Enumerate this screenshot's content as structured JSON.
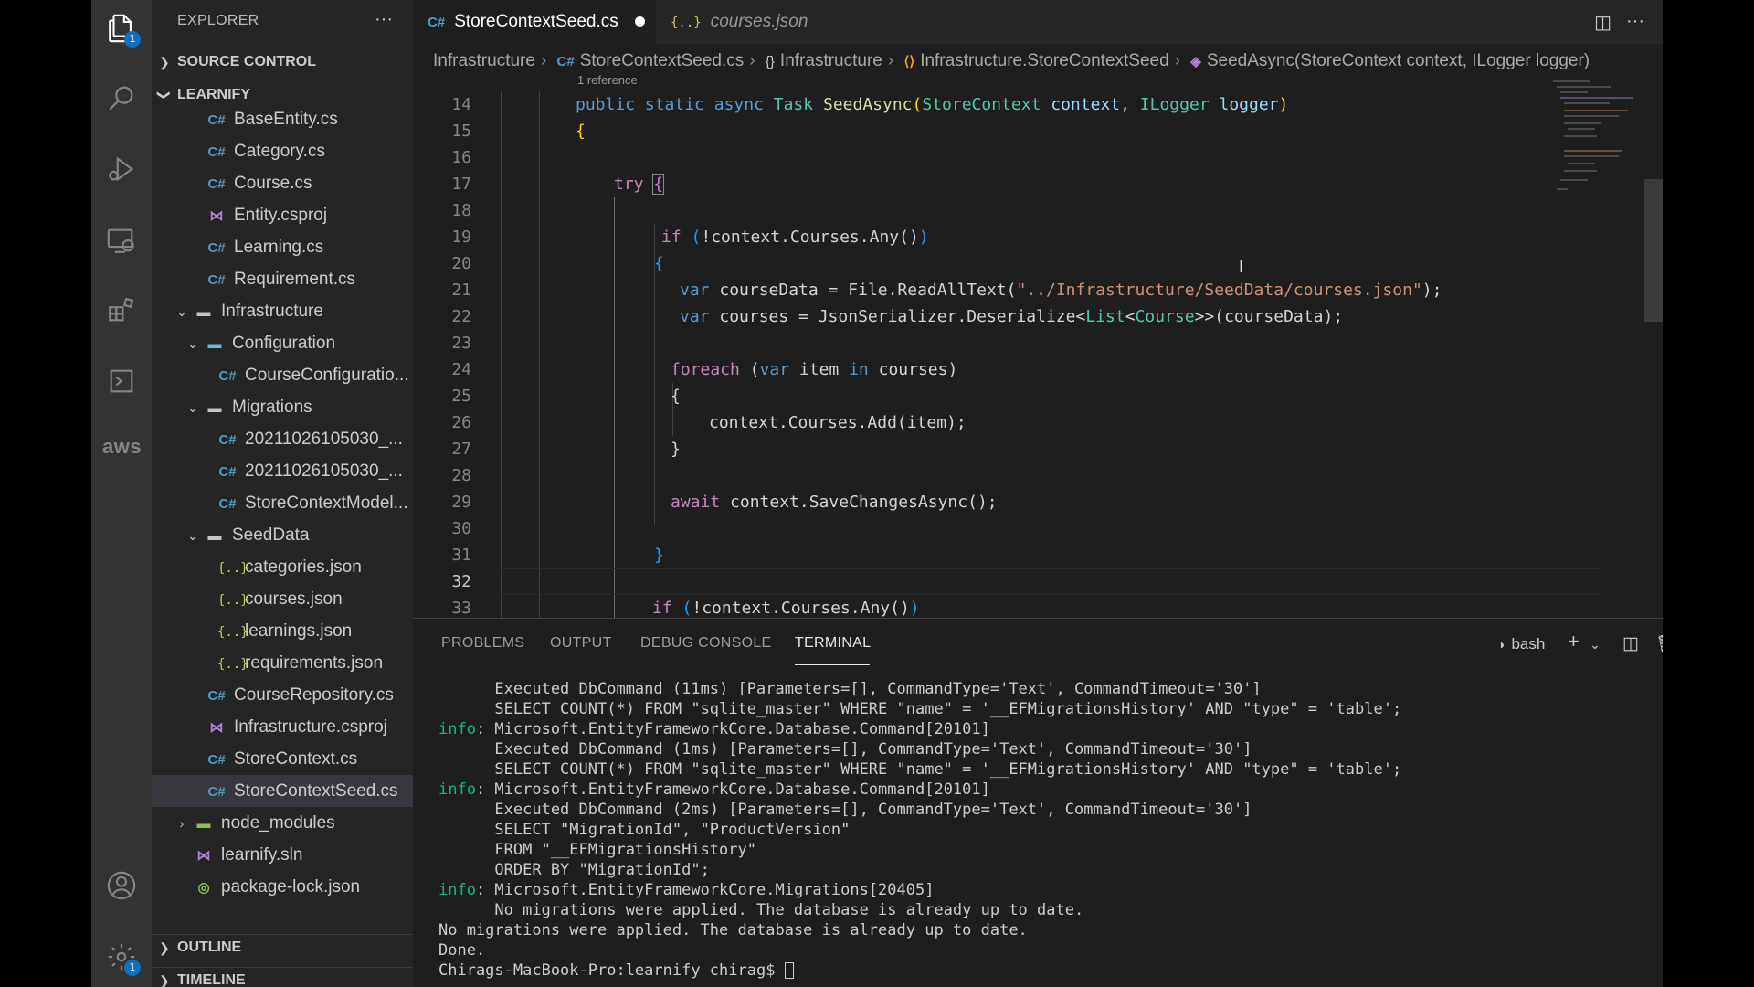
{
  "sidebar": {
    "title": "EXPLORER",
    "more": "···",
    "sections": {
      "source_control": "SOURCE CONTROL",
      "project": "LEARNIFY",
      "outline": "OUTLINE",
      "timeline": "TIMELINE"
    },
    "files": [
      {
        "label": "BaseEntity.cs",
        "icon": "C#"
      },
      {
        "label": "Category.cs",
        "icon": "C#"
      },
      {
        "label": "Course.cs",
        "icon": "C#"
      },
      {
        "label": "Entity.csproj",
        "icon": "csproj"
      },
      {
        "label": "Learning.cs",
        "icon": "C#"
      },
      {
        "label": "Requirement.cs",
        "icon": "C#"
      },
      {
        "label": "Infrastructure",
        "icon": "folder"
      },
      {
        "label": "Configuration",
        "icon": "folder"
      },
      {
        "label": "CourseConfiguratio...",
        "icon": "C#"
      },
      {
        "label": "Migrations",
        "icon": "folder"
      },
      {
        "label": "20211026105030_...",
        "icon": "C#"
      },
      {
        "label": "20211026105030_...",
        "icon": "C#"
      },
      {
        "label": "StoreContextModel...",
        "icon": "C#"
      },
      {
        "label": "SeedData",
        "icon": "folder"
      },
      {
        "label": "categories.json",
        "icon": "{..}"
      },
      {
        "label": "courses.json",
        "icon": "{..}"
      },
      {
        "label": "learnings.json",
        "icon": "{..}"
      },
      {
        "label": "requirements.json",
        "icon": "{..}"
      },
      {
        "label": "CourseRepository.cs",
        "icon": "C#"
      },
      {
        "label": "Infrastructure.csproj",
        "icon": "csproj"
      },
      {
        "label": "StoreContext.cs",
        "icon": "C#"
      },
      {
        "label": "StoreContextSeed.cs",
        "icon": "C#"
      },
      {
        "label": "node_modules",
        "icon": "folder"
      },
      {
        "label": "learnify.sln",
        "icon": "sln"
      },
      {
        "label": "package-lock.json",
        "icon": "lock"
      }
    ]
  },
  "activity_bar": {
    "explorer_badge": "1",
    "settings_badge": "1",
    "aws_label": "aws"
  },
  "tabs": [
    {
      "label": "StoreContextSeed.cs",
      "icon": "C#"
    },
    {
      "label": "courses.json",
      "icon": "{..}"
    }
  ],
  "breadcrumb": {
    "items": [
      "Infrastructure",
      "StoreContextSeed.cs",
      "Infrastructure",
      "Infrastructure.StoreContextSeed",
      "SeedAsync(StoreContext context, ILogger logger)"
    ],
    "icons": [
      "",
      "C#",
      "{}",
      "⟨⟩",
      "◈"
    ]
  },
  "editor": {
    "codelens": "1 reference",
    "line_numbers": [
      "14",
      "15",
      "16",
      "17",
      "18",
      "19",
      "20",
      "21",
      "22",
      "23",
      "24",
      "25",
      "26",
      "27",
      "28",
      "29",
      "30",
      "31",
      "32",
      "33"
    ],
    "current_line": "32",
    "tokens": {
      "l14": [
        "public",
        "static",
        "async",
        "Task",
        "SeedAsync",
        "(",
        "StoreContext",
        " context, ",
        "ILogger",
        " logger",
        ")"
      ],
      "l15": [
        "{"
      ],
      "l17": [
        "try",
        " ",
        "{"
      ],
      "l19": [
        "if",
        " (",
        "!context.Courses.Any()",
        ")"
      ],
      "l20": [
        "{"
      ],
      "l21": [
        "var",
        " courseData = File.ReadAllText(",
        "\"../Infrastructure/SeedData/courses.json\"",
        ");"
      ],
      "l22": [
        "var",
        " courses = JsonSerializer.Deserialize<",
        "List",
        "<",
        "Course",
        ">>(courseData);"
      ],
      "l24": [
        "foreach",
        " (",
        "var",
        " item ",
        "in",
        " courses",
        ")"
      ],
      "l25": [
        "{"
      ],
      "l26": [
        "context.Courses.Add(item);"
      ],
      "l27": [
        "}"
      ],
      "l29": [
        "await",
        " context.SaveChangesAsync();"
      ],
      "l31": [
        "}"
      ],
      "l33": [
        "if",
        " (",
        "!context.Courses.Any()",
        ")"
      ]
    }
  },
  "panel": {
    "tabs": [
      "PROBLEMS",
      "OUTPUT",
      "DEBUG CONSOLE",
      "TERMINAL"
    ],
    "shell": "bash",
    "terminal_lines": [
      {
        "prefix": "",
        "text": "      Executed DbCommand (11ms) [Parameters=[], CommandType='Text', CommandTimeout='30']"
      },
      {
        "prefix": "",
        "text": "      SELECT COUNT(*) FROM \"sqlite_master\" WHERE \"name\" = '__EFMigrationsHistory' AND \"type\" = 'table';"
      },
      {
        "prefix": "info",
        "text": ": Microsoft.EntityFrameworkCore.Database.Command[20101]"
      },
      {
        "prefix": "",
        "text": "      Executed DbCommand (1ms) [Parameters=[], CommandType='Text', CommandTimeout='30']"
      },
      {
        "prefix": "",
        "text": "      SELECT COUNT(*) FROM \"sqlite_master\" WHERE \"name\" = '__EFMigrationsHistory' AND \"type\" = 'table';"
      },
      {
        "prefix": "info",
        "text": ": Microsoft.EntityFrameworkCore.Database.Command[20101]"
      },
      {
        "prefix": "",
        "text": "      Executed DbCommand (2ms) [Parameters=[], CommandType='Text', CommandTimeout='30']"
      },
      {
        "prefix": "",
        "text": "      SELECT \"MigrationId\", \"ProductVersion\""
      },
      {
        "prefix": "",
        "text": "      FROM \"__EFMigrationsHistory\""
      },
      {
        "prefix": "",
        "text": "      ORDER BY \"MigrationId\";"
      },
      {
        "prefix": "info",
        "text": ": Microsoft.EntityFrameworkCore.Migrations[20405]"
      },
      {
        "prefix": "",
        "text": "      No migrations were applied. The database is already up to date."
      },
      {
        "prefix": "",
        "text": "No migrations were applied. The database is already up to date."
      },
      {
        "prefix": "",
        "text": "Done."
      },
      {
        "prefix": "",
        "text": "Chirags-MacBook-Pro:learnify chirag$ "
      }
    ]
  }
}
